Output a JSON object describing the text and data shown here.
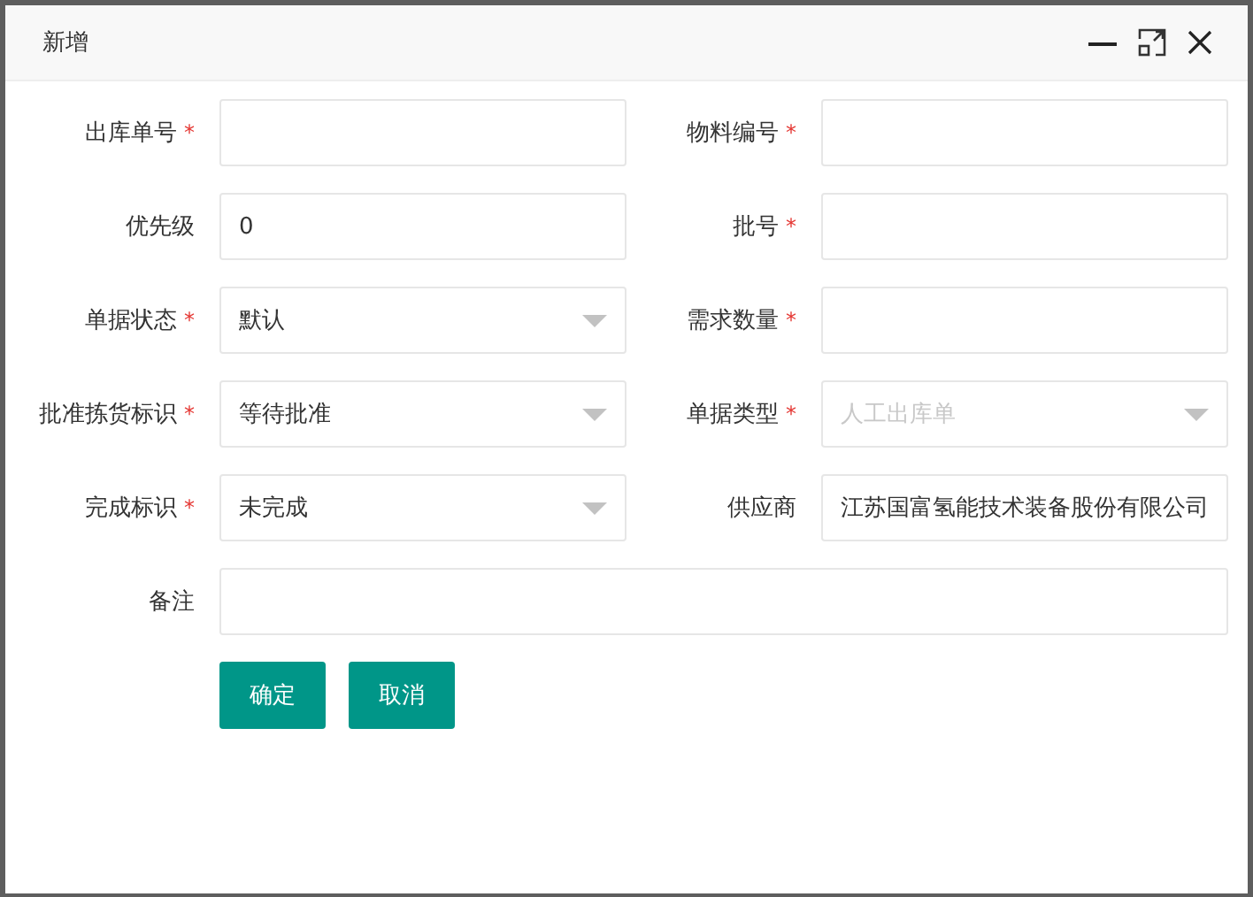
{
  "window": {
    "title": "新增"
  },
  "required_mark": "*",
  "fields": [
    {
      "label": "出库单号",
      "kind": "input",
      "required": true
    },
    {
      "label": "物料编号",
      "kind": "input",
      "required": true
    },
    {
      "label": "优先级",
      "kind": "input",
      "required": false,
      "value": "0"
    },
    {
      "label": "批号",
      "kind": "input",
      "required": true
    },
    {
      "label": "单据状态",
      "kind": "select",
      "required": true,
      "value": "默认",
      "disabled": false
    },
    {
      "label": "需求数量",
      "kind": "input",
      "required": true
    },
    {
      "label": "批准拣货标识",
      "kind": "select",
      "required": true,
      "value": "等待批准",
      "disabled": false
    },
    {
      "label": "单据类型",
      "kind": "select",
      "required": true,
      "value": "人工出库单",
      "disabled": true
    },
    {
      "label": "完成标识",
      "kind": "select",
      "required": true,
      "value": "未完成",
      "disabled": false
    },
    {
      "label": "供应商",
      "kind": "input",
      "required": false,
      "value": "江苏国富氢能技术装备股份有限公司"
    },
    {
      "label": "备注",
      "kind": "wide",
      "required": false
    }
  ],
  "buttons": [
    "确定",
    "取消"
  ]
}
